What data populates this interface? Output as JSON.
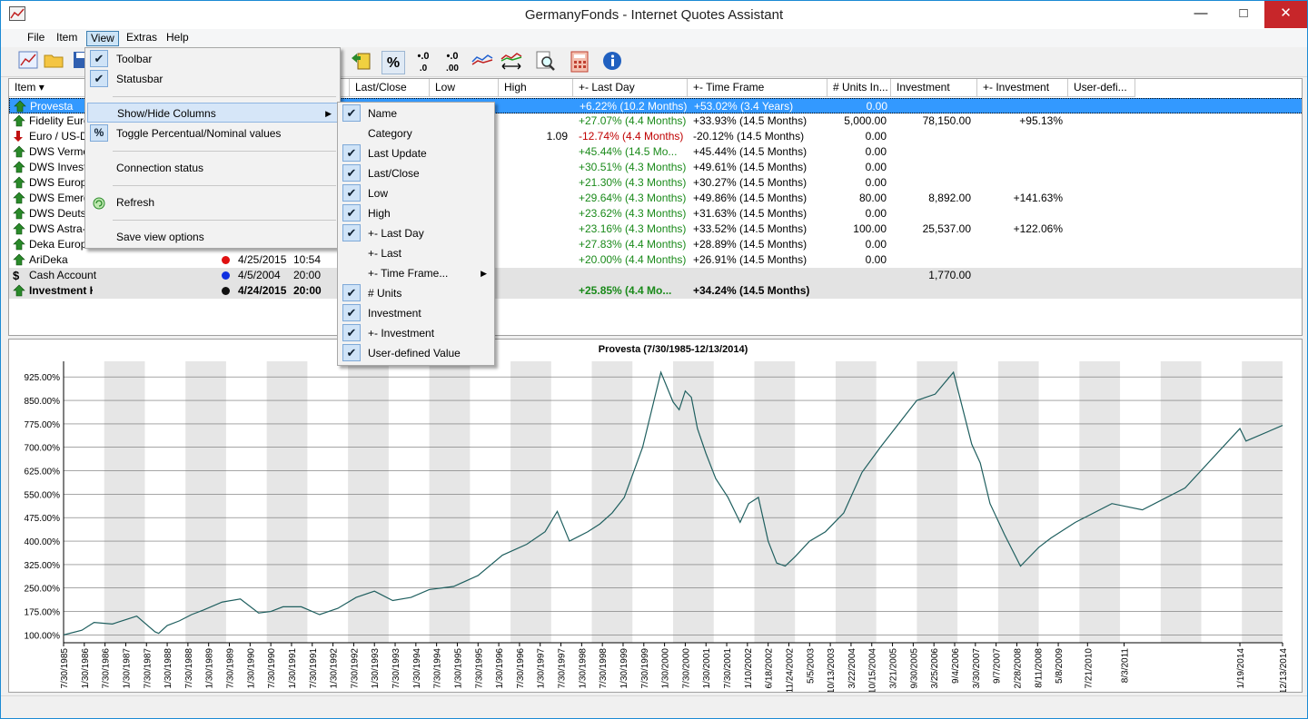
{
  "window": {
    "title": "GermanyFonds - Internet Quotes Assistant",
    "minimize": "—",
    "maximize": "□",
    "close": "✕"
  },
  "menu": [
    "File",
    "Item",
    "View",
    "Extras",
    "Help"
  ],
  "toolbar_icons": [
    "chart-icon",
    "folder-open-icon",
    "save-icon",
    "update-icon",
    "percent-icon",
    "decimal-increase-icon",
    "decimal-decrease-icon",
    "chart-lines-icon",
    "chart-compare-icon",
    "search-icon",
    "calculator-icon",
    "info-icon"
  ],
  "toolbar_text": {
    "percent": "%",
    "dec_up": "•.0",
    "dec_down": "•.0"
  },
  "columns": [
    {
      "label": "Item"
    },
    {
      "label": "Last/Close"
    },
    {
      "label": "Low"
    },
    {
      "label": "High"
    },
    {
      "label": "+- Last Day"
    },
    {
      "label": "+- Time Frame"
    },
    {
      "label": "# Units In..."
    },
    {
      "label": "Investment"
    },
    {
      "label": "+- Investment"
    },
    {
      "label": "User-defi..."
    }
  ],
  "rows": [
    {
      "name": "Provesta",
      "dir": "up",
      "date": "",
      "time": "",
      "close": "",
      "high": "",
      "lastday": "+6.22% (10.2 Months)",
      "timeframe": "+53.02% (3.4 Years)",
      "units": "0.00",
      "investment": "",
      "invpct": ""
    },
    {
      "name": "Fidelity Euro",
      "dir": "up",
      "date": "",
      "time": "",
      "close": "",
      "high": "",
      "lastday": "+27.07% (4.4 Months)",
      "timeframe": "+33.93% (14.5 Months)",
      "units": "5,000.00",
      "investment": "78,150.00",
      "invpct": "+95.13%"
    },
    {
      "name": "Euro / US-D",
      "dir": "down",
      "date": "",
      "time": "",
      "close": "",
      "high": "1.09",
      "lastday": "-12.74% (4.4 Months)",
      "timeframe": "-20.12% (14.5 Months)",
      "units": "0.00",
      "investment": "",
      "invpct": ""
    },
    {
      "name": "DWS Vermö",
      "dir": "up",
      "date": "",
      "time": "",
      "close": "",
      "high": "",
      "lastday": "+45.44% (14.5 Mo...",
      "timeframe": "+45.44% (14.5 Months)",
      "units": "0.00",
      "investment": "",
      "invpct": ""
    },
    {
      "name": "DWS Invest",
      "dir": "up",
      "date": "",
      "time": "",
      "close": "",
      "high": "",
      "lastday": "+30.51% (4.3 Months)",
      "timeframe": "+49.61% (14.5 Months)",
      "units": "0.00",
      "investment": "",
      "invpct": ""
    },
    {
      "name": "DWS Europa",
      "dir": "up",
      "date": "",
      "time": "",
      "close": "",
      "high": "",
      "lastday": "+21.30% (4.3 Months)",
      "timeframe": "+30.27% (14.5 Months)",
      "units": "0.00",
      "investment": "",
      "invpct": ""
    },
    {
      "name": "DWS Emerg",
      "dir": "up",
      "date": "",
      "time": "",
      "close": "",
      "high": "",
      "lastday": "+29.64% (4.3 Months)",
      "timeframe": "+49.86% (14.5 Months)",
      "units": "80.00",
      "investment": "8,892.00",
      "invpct": "+141.63%"
    },
    {
      "name": "DWS Deutsc",
      "dir": "up",
      "date": "",
      "time": "",
      "close": "",
      "high": "",
      "lastday": "+23.62% (4.3 Months)",
      "timeframe": "+31.63% (14.5 Months)",
      "units": "0.00",
      "investment": "",
      "invpct": ""
    },
    {
      "name": "DWS Astra-I",
      "dir": "up",
      "date": "",
      "time": "",
      "close": "",
      "high": "",
      "lastday": "+23.16% (4.3 Months)",
      "timeframe": "+33.52% (14.5 Months)",
      "units": "100.00",
      "investment": "25,537.00",
      "invpct": "+122.06%"
    },
    {
      "name": "Deka Europa",
      "dir": "up",
      "date": "",
      "time": "",
      "close": "",
      "high": "",
      "lastday": "+27.83% (4.4 Months)",
      "timeframe": "+28.89% (14.5 Months)",
      "units": "0.00",
      "investment": "",
      "invpct": ""
    },
    {
      "name": "AriDeka",
      "dir": "up",
      "dot": "#e01010",
      "date": "4/25/2015",
      "time": "10:54",
      "close": "",
      "high": "",
      "lastday": "+20.00% (4.4 Months)",
      "timeframe": "+26.91% (14.5 Months)",
      "units": "0.00",
      "investment": "",
      "invpct": ""
    },
    {
      "name": "Cash Account",
      "dir": "dollar",
      "dot": "#1030e0",
      "date": "4/5/2004",
      "time": "20:00",
      "close": "",
      "high": "",
      "lastday": "",
      "timeframe": "",
      "units": "",
      "investment": "1,770.00",
      "invpct": ""
    },
    {
      "name": "Investment History",
      "dir": "up",
      "dot": "#111111",
      "date": "4/24/2015",
      "time": "20:00",
      "close": "",
      "high": "",
      "lastday": "+25.85% (4.4 Mo...",
      "timeframe": "+34.24% (14.5 Months)",
      "units": "",
      "investment": "",
      "invpct": ""
    }
  ],
  "view_menu": {
    "items": [
      {
        "label": "Toolbar",
        "checked": true
      },
      {
        "label": "Statusbar",
        "checked": true
      },
      {
        "label": "Show/Hide Columns",
        "checked": false,
        "submenu": true
      },
      {
        "label": "Toggle Percentual/Nominal values",
        "checked": false,
        "icon": "%"
      },
      {
        "label": "Connection status",
        "checked": false
      },
      {
        "label": "Refresh",
        "checked": false
      },
      {
        "label": "Save view options",
        "checked": false
      }
    ]
  },
  "columns_menu": {
    "items": [
      {
        "label": "Name",
        "checked": true
      },
      {
        "label": "Category",
        "checked": false
      },
      {
        "label": "Last Update",
        "checked": true
      },
      {
        "label": "Last/Close",
        "checked": true
      },
      {
        "label": "Low",
        "checked": true
      },
      {
        "label": "High",
        "checked": true
      },
      {
        "label": "+- Last Day",
        "checked": true
      },
      {
        "label": "+- Last",
        "checked": false
      },
      {
        "label": "+- Time Frame...",
        "checked": false,
        "submenu": true
      },
      {
        "label": "# Units",
        "checked": true
      },
      {
        "label": "Investment",
        "checked": true
      },
      {
        "label": "+- Investment",
        "checked": true
      },
      {
        "label": "User-defined Value",
        "checked": true
      }
    ]
  },
  "chart_data": {
    "type": "line",
    "title": "Provesta (7/30/1985-12/13/2014)",
    "ylim": [
      75,
      975
    ],
    "y_ticks": [
      "100.00%",
      "175.00%",
      "250.00%",
      "325.00%",
      "400.00%",
      "475.00%",
      "550.00%",
      "625.00%",
      "700.00%",
      "775.00%",
      "850.00%",
      "925.00%"
    ],
    "y_tick_values": [
      100,
      175,
      250,
      325,
      400,
      475,
      550,
      625,
      700,
      775,
      850,
      925
    ],
    "x_ticks": [
      "7/30/1985",
      "1/30/1986",
      "7/30/1986",
      "1/30/1987",
      "7/30/1987",
      "1/30/1988",
      "7/30/1988",
      "1/30/1989",
      "7/30/1989",
      "1/30/1990",
      "7/30/1990",
      "1/30/1991",
      "7/30/1991",
      "1/30/1992",
      "7/30/1992",
      "1/30/1993",
      "7/30/1993",
      "1/30/1994",
      "7/30/1994",
      "1/30/1995",
      "7/30/1995",
      "1/30/1996",
      "7/30/1996",
      "1/30/1997",
      "7/30/1997",
      "1/30/1998",
      "7/30/1998",
      "1/30/1999",
      "7/30/1999",
      "1/30/2000",
      "7/30/2000",
      "1/30/2001",
      "7/30/2001",
      "1/10/2002",
      "6/18/2002",
      "11/24/2002",
      "5/5/2003",
      "10/13/2003",
      "3/22/2004",
      "10/15/2004",
      "3/21/2005",
      "9/30/2005",
      "3/25/2006",
      "9/4/2006",
      "3/30/2007",
      "9/7/2007",
      "2/28/2008",
      "8/11/2008",
      "5/8/2009",
      "7/21/2010",
      "8/3/2011",
      "1/19/2014",
      "12/13/2014"
    ],
    "x_tick_pos": [
      0.0,
      0.017,
      0.034,
      0.051,
      0.068,
      0.085,
      0.102,
      0.119,
      0.136,
      0.153,
      0.17,
      0.187,
      0.204,
      0.221,
      0.238,
      0.255,
      0.272,
      0.289,
      0.306,
      0.323,
      0.34,
      0.357,
      0.374,
      0.391,
      0.408,
      0.425,
      0.442,
      0.459,
      0.476,
      0.493,
      0.51,
      0.527,
      0.544,
      0.561,
      0.578,
      0.595,
      0.612,
      0.629,
      0.646,
      0.663,
      0.68,
      0.697,
      0.714,
      0.731,
      0.748,
      0.765,
      0.782,
      0.799,
      0.816,
      0.84,
      0.87,
      0.965,
      1.0
    ],
    "series": [
      {
        "name": "Provesta",
        "color": "#1f5f5f",
        "x": [
          0.0,
          0.015,
          0.025,
          0.04,
          0.06,
          0.075,
          0.078,
          0.085,
          0.095,
          0.105,
          0.115,
          0.13,
          0.145,
          0.16,
          0.17,
          0.18,
          0.195,
          0.21,
          0.225,
          0.24,
          0.255,
          0.27,
          0.285,
          0.3,
          0.32,
          0.34,
          0.36,
          0.38,
          0.395,
          0.405,
          0.415,
          0.43,
          0.44,
          0.45,
          0.46,
          0.475,
          0.49,
          0.5,
          0.505,
          0.51,
          0.515,
          0.52,
          0.527,
          0.535,
          0.545,
          0.555,
          0.562,
          0.57,
          0.578,
          0.585,
          0.592,
          0.6,
          0.612,
          0.625,
          0.64,
          0.655,
          0.67,
          0.685,
          0.7,
          0.715,
          0.73,
          0.745,
          0.752,
          0.76,
          0.772,
          0.785,
          0.8,
          0.81,
          0.83,
          0.86,
          0.885,
          0.92,
          0.965,
          0.97,
          1.0
        ],
        "y": [
          100,
          115,
          140,
          135,
          160,
          110,
          105,
          130,
          145,
          165,
          180,
          205,
          215,
          170,
          175,
          190,
          190,
          165,
          185,
          220,
          240,
          210,
          220,
          245,
          255,
          290,
          355,
          390,
          430,
          495,
          400,
          430,
          455,
          490,
          540,
          700,
          940,
          845,
          820,
          880,
          860,
          760,
          680,
          600,
          540,
          460,
          520,
          540,
          400,
          330,
          320,
          350,
          400,
          430,
          490,
          620,
          700,
          775,
          850,
          870,
          940,
          710,
          650,
          520,
          420,
          320,
          380,
          410,
          460,
          520,
          500,
          570,
          760,
          720,
          770
        ]
      }
    ]
  }
}
